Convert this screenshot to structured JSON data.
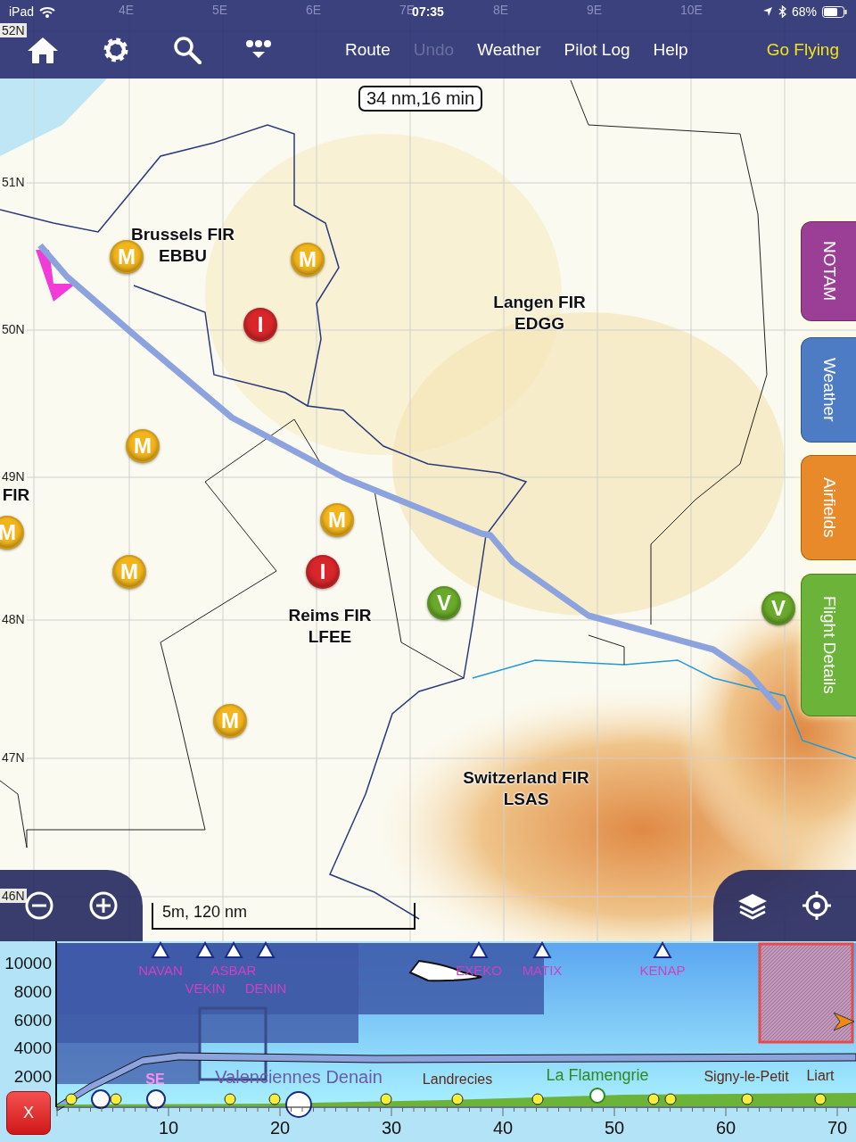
{
  "status_bar": {
    "device": "iPad",
    "time": "07:35",
    "battery": "68%"
  },
  "toolbar": {
    "menu": [
      {
        "label": "Route",
        "disabled": false,
        "kind": "normal"
      },
      {
        "label": "Undo",
        "disabled": true,
        "kind": "normal"
      },
      {
        "label": "Weather",
        "disabled": false,
        "kind": "normal"
      },
      {
        "label": "Pilot Log",
        "disabled": false,
        "kind": "normal"
      },
      {
        "label": "Help",
        "disabled": false,
        "kind": "normal"
      },
      {
        "label": "Go Flying",
        "disabled": false,
        "kind": "primary"
      }
    ]
  },
  "map": {
    "route_summary": "34 nm,16 min",
    "scale": "5m, 120 nm",
    "longitudes": [
      "4E",
      "5E",
      "6E",
      "7E",
      "8E",
      "9E",
      "10E"
    ],
    "latitudes": [
      "52N",
      "51N",
      "50N",
      "49N",
      "48N",
      "47N",
      "46N"
    ],
    "regions": [
      {
        "name": "Brussels FIR",
        "code": "EBBU"
      },
      {
        "name": "Langen FIR",
        "code": "EDGG"
      },
      {
        "name": "Reims FIR",
        "code": "LFEE"
      },
      {
        "name": "Switzerland FIR",
        "code": "LSAS"
      },
      {
        "name": "FIR"
      }
    ],
    "airfields": [
      {
        "label": "M",
        "kind": "military"
      },
      {
        "label": "M",
        "kind": "military"
      },
      {
        "label": "I",
        "kind": "ifr"
      },
      {
        "label": "M",
        "kind": "military"
      },
      {
        "label": "M",
        "kind": "military"
      },
      {
        "label": "M",
        "kind": "military"
      },
      {
        "label": "M",
        "kind": "military"
      },
      {
        "label": "I",
        "kind": "ifr"
      },
      {
        "label": "V",
        "kind": "vfr"
      },
      {
        "label": "V",
        "kind": "vfr"
      },
      {
        "label": "M",
        "kind": "military"
      }
    ]
  },
  "side_tabs": [
    {
      "label": "NOTAM",
      "color": "#9b3f96"
    },
    {
      "label": "Weather",
      "color": "#4e7cc4"
    },
    {
      "label": "Airfields",
      "color": "#e88a2a"
    },
    {
      "label": "Flight Details",
      "color": "#6cb33a"
    }
  ],
  "profile": {
    "close": "X",
    "y_axis": [
      "10000",
      "8000",
      "6000",
      "4000",
      "2000"
    ],
    "x_axis": [
      "10",
      "20",
      "30",
      "40",
      "50",
      "60",
      "70"
    ],
    "waypoints": [
      "NAVAN",
      "VEKIN",
      "ASBAR",
      "DENIN",
      "EXEKO",
      "MATIX",
      "KENAP"
    ],
    "places": [
      {
        "label": "SE",
        "kind": "point"
      },
      {
        "label": "Valenciennes Denain",
        "kind": "airspace"
      },
      {
        "label": "Landrecies",
        "kind": "town"
      },
      {
        "label": "La Flamengrie",
        "kind": "airfield"
      },
      {
        "label": "Signy-le-Petit",
        "kind": "town"
      },
      {
        "label": "Liart",
        "kind": "town"
      }
    ]
  }
}
